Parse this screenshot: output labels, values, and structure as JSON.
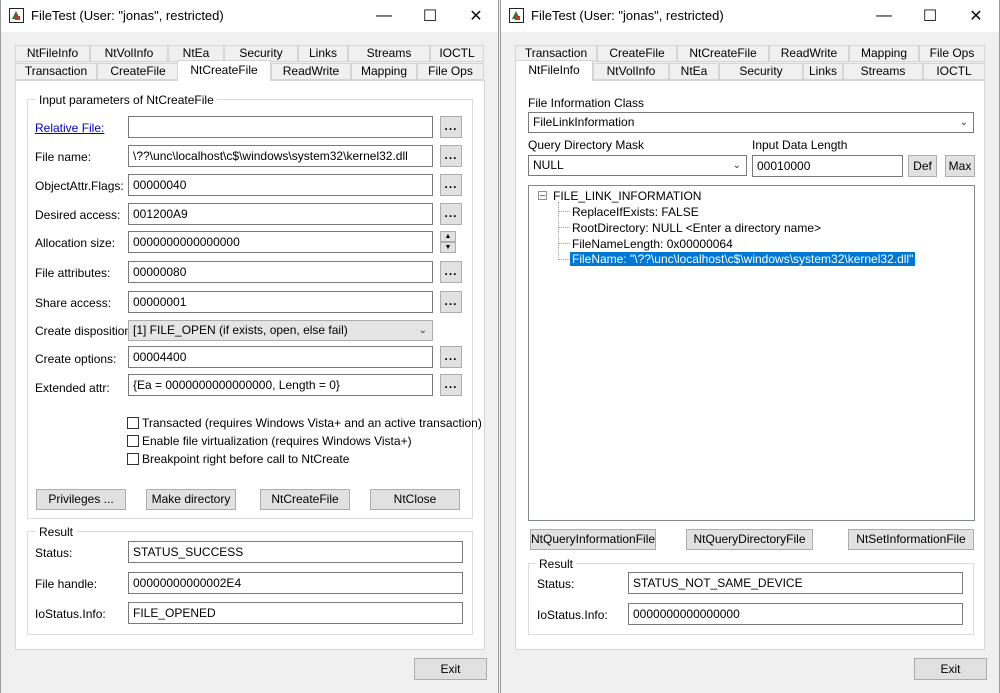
{
  "left_window": {
    "title": "FileTest (User: \"jonas\", restricted)",
    "tabs_row1": [
      "NtFileInfo",
      "NtVolInfo",
      "NtEa",
      "Security",
      "Links",
      "Streams",
      "IOCTL"
    ],
    "tabs_row2": [
      "Transaction",
      "CreateFile",
      "NtCreateFile",
      "ReadWrite",
      "Mapping",
      "File Ops"
    ],
    "selected_tab": "NtCreateFile",
    "input_group_title": "Input parameters of NtCreateFile",
    "fields": {
      "relative_file": {
        "label": "Relative File:",
        "value": ""
      },
      "file_name": {
        "label": "File name:",
        "value": "\\??\\unc\\localhost\\c$\\windows\\system32\\kernel32.dll"
      },
      "objattr_flags": {
        "label": "ObjectAttr.Flags:",
        "value": "00000040"
      },
      "desired_access": {
        "label": "Desired access:",
        "value": "001200A9"
      },
      "allocation_size": {
        "label": "Allocation size:",
        "value": "0000000000000000"
      },
      "file_attributes": {
        "label": "File attributes:",
        "value": "00000080"
      },
      "share_access": {
        "label": "Share access:",
        "value": "00000001"
      },
      "create_disposition": {
        "label": "Create disposition:",
        "value": "[1] FILE_OPEN (if exists, open, else fail)"
      },
      "create_options": {
        "label": "Create options:",
        "value": "00004400"
      },
      "extended_attr": {
        "label": "Extended attr:",
        "value": "{Ea = 0000000000000000, Length = 0}"
      }
    },
    "dots_label": "...",
    "checkboxes": {
      "transacted": "Transacted (requires Windows Vista+ and an active transaction)",
      "virtualization": "Enable file virtualization (requires Windows Vista+)",
      "breakpoint": "Breakpoint right before call to NtCreate"
    },
    "buttons": {
      "privileges": "Privileges ...",
      "make_directory": "Make directory",
      "ntcreatefile": "NtCreateFile",
      "ntclose": "NtClose"
    },
    "result": {
      "title": "Result",
      "status_label": "Status:",
      "status_value": "STATUS_SUCCESS",
      "handle_label": "File handle:",
      "handle_value": "00000000000002E4",
      "info_label": "IoStatus.Info:",
      "info_value": "FILE_OPENED"
    },
    "exit_label": "Exit"
  },
  "right_window": {
    "title": "FileTest (User: \"jonas\", restricted)",
    "tabs_row1": [
      "Transaction",
      "CreateFile",
      "NtCreateFile",
      "ReadWrite",
      "Mapping",
      "File Ops"
    ],
    "tabs_row2": [
      "NtFileInfo",
      "NtVolInfo",
      "NtEa",
      "Security",
      "Links",
      "Streams",
      "IOCTL"
    ],
    "selected_tab": "NtFileInfo",
    "file_info_class_label": "File Information Class",
    "file_info_class_value": "FileLinkInformation",
    "query_mask_label": "Query Directory Mask",
    "query_mask_value": "NULL",
    "input_length_label": "Input Data Length",
    "input_length_value": "00010000",
    "def_label": "Def",
    "max_label": "Max",
    "tree": {
      "root": "FILE_LINK_INFORMATION",
      "items": [
        "ReplaceIfExists: FALSE",
        "RootDirectory: NULL <Enter a directory name>",
        "FileNameLength: 0x00000064",
        "FileName: \"\\??\\unc\\localhost\\c$\\windows\\system32\\kernel32.dll\""
      ]
    },
    "buttons": {
      "query_info": "NtQueryInformationFile",
      "query_dir": "NtQueryDirectoryFile",
      "set_info": "NtSetInformationFile"
    },
    "result": {
      "title": "Result",
      "status_label": "Status:",
      "status_value": "STATUS_NOT_SAME_DEVICE",
      "info_label": "IoStatus.Info:",
      "info_value": "0000000000000000"
    },
    "exit_label": "Exit"
  },
  "colors": {
    "selection": "#0078d7",
    "link": "#0000cc"
  },
  "icons": [
    "app-icon",
    "minimize-icon",
    "maximize-icon",
    "close-icon",
    "spin-up-icon",
    "spin-down-icon",
    "chevron-down-icon",
    "tree-collapse-icon"
  ]
}
